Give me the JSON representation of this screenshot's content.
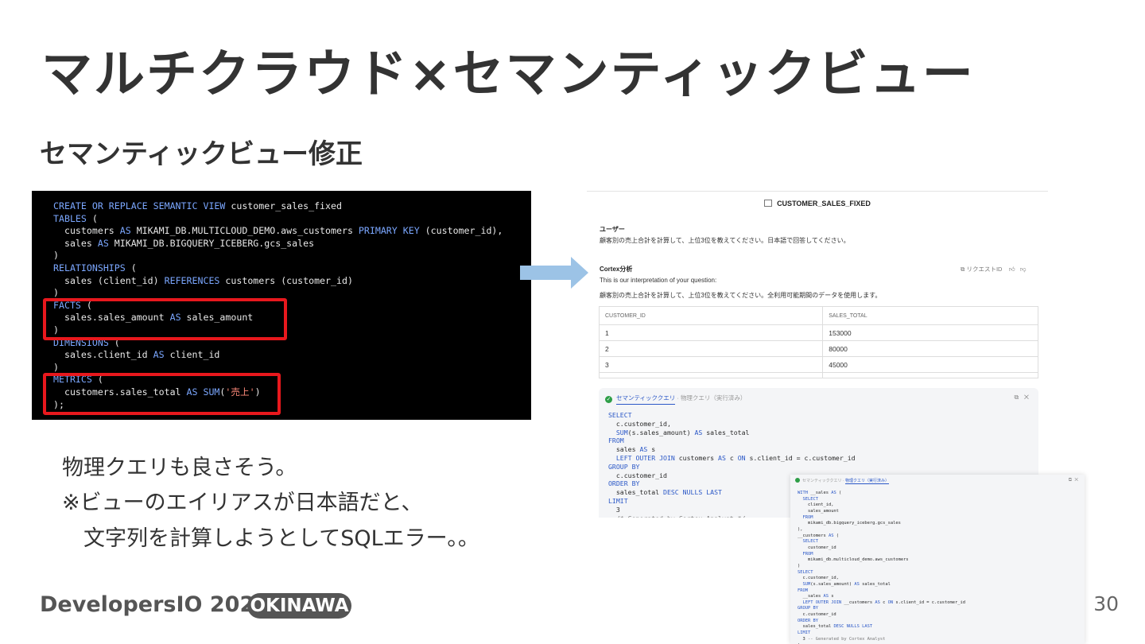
{
  "slide": {
    "title": "マルチクラウド×セマンティックビュー",
    "subtitle": "セマンティックビュー修正",
    "notes": [
      "物理クエリも良さそう。",
      "※ビューのエイリアスが日本語だと、",
      "　文字列を計算しようとしてSQLエラー。。"
    ],
    "footer_brand": "DevelopersIO 2025",
    "footer_badge": "OKINAWA",
    "page_number": "30",
    "highlight_color": "#e8181d",
    "arrow_color": "#9cc3e6"
  },
  "code": {
    "lines": [
      "CREATE OR REPLACE SEMANTIC VIEW customer_sales_fixed",
      "TABLES (",
      "  customers AS MIKAMI_DB.MULTICLOUD_DEMO.aws_customers PRIMARY KEY (customer_id),",
      "  sales AS MIKAMI_DB.BIGQUERY_ICEBERG.gcs_sales",
      ")",
      "RELATIONSHIPS (",
      "  sales (client_id) REFERENCES customers (customer_id)",
      ")",
      "FACTS (",
      "  sales.sales_amount AS sales_amount",
      ")",
      "DIMENSIONS (",
      "  sales.client_id AS client_id",
      ")",
      "METRICS (",
      "  customers.sales_total AS SUM('売上')",
      ");"
    ]
  },
  "result": {
    "view_name": "CUSTOMER_SALES_FIXED",
    "user_label": "ユーザー",
    "user_question": "顧客別の売上合計を計算して、上位3位を教えてください。日本語で回答してください。",
    "cortex_label": "Cortex分析",
    "request_id_label": "リクエストID",
    "interpretation_intro": "This is our interpretation of your question:",
    "interpretation": "顧客別の売上合計を計算して、上位3位を教えてください。全利用可能期間のデータを使用します。",
    "table": {
      "columns": [
        "CUSTOMER_ID",
        "SALES_TOTAL"
      ],
      "rows": [
        [
          "1",
          "153000"
        ],
        [
          "2",
          "80000"
        ],
        [
          "3",
          "45000"
        ],
        [
          "",
          ""
        ]
      ]
    },
    "sql_tab_semantic": "セマンティッククエリ",
    "sql_tab_physical": "物理クエリ（実行済み）",
    "sql_lines": [
      "SELECT",
      "  c.customer_id,",
      "  SUM(s.sales_amount) AS sales_total",
      "FROM",
      "  sales AS s",
      "  LEFT OUTER JOIN customers AS c ON s.client_id = c.customer_id",
      "GROUP BY",
      "  c.customer_id",
      "ORDER BY",
      "  sales_total DESC NULLS LAST",
      "LIMIT",
      "  3",
      "  /* Generated by Cortex Analyst */"
    ]
  },
  "physical_query": {
    "tab_semantic": "セマンティッククエリ",
    "tab_physical": "物理クエリ（実行済み）",
    "sql_lines": [
      "WITH __sales AS (",
      "  SELECT",
      "    client_id,",
      "    sales_amount",
      "  FROM",
      "    mikami_db.bigquery_iceberg.gcs_sales",
      "),",
      "__customers AS (",
      "  SELECT",
      "    customer_id",
      "  FROM",
      "    mikami_db.multicloud_demo.aws_customers",
      ")",
      "SELECT",
      "  c.customer_id,",
      "  SUM(s.sales_amount) AS sales_total",
      "FROM",
      "  __sales AS s",
      "  LEFT OUTER JOIN __customers AS c ON s.client_id = c.customer_id",
      "GROUP BY",
      "  c.customer_id",
      "ORDER BY",
      "  sales_total DESC NULLS LAST",
      "LIMIT",
      "  3 -- Generated by Cortex Analyst",
      ";"
    ]
  }
}
